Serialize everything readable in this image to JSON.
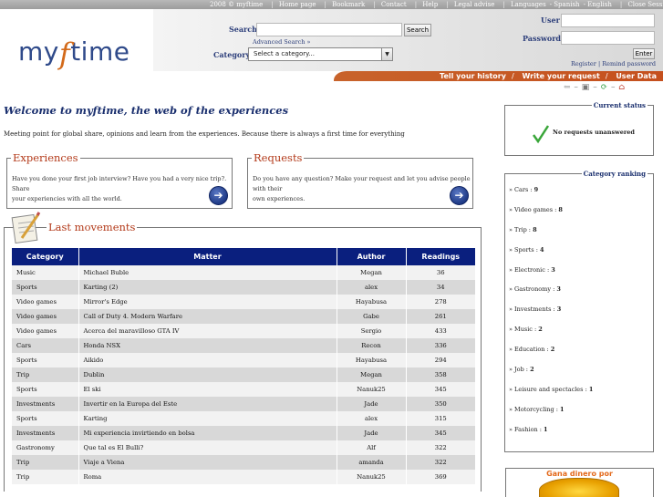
{
  "topbar": {
    "copyright": "2008 © myftime",
    "links": [
      "Home page",
      "Bookmark",
      "Contact",
      "Help",
      "Legal advise"
    ],
    "languages_label": "Languages",
    "languages": [
      "Spanish",
      "English"
    ],
    "close_session": "Close Session"
  },
  "logo": {
    "pre": "my",
    "f": "f",
    "post": "time"
  },
  "search": {
    "label": "Search",
    "button": "Search",
    "advanced": "Advanced Search »",
    "category_label": "Category",
    "category_value": "Select a category..."
  },
  "login": {
    "user_label": "User",
    "password_label": "Password",
    "enter_button": "Enter",
    "register": "Register",
    "remind": "Remind password"
  },
  "nav": {
    "items": [
      "Tell your history",
      "Write your request",
      "User Data"
    ]
  },
  "welcome": {
    "title": "Welcome to myftime, the web of the experiences",
    "intro": "Meeting point for global share, opinions and learn from the experiences. Because there is always a first time for everything"
  },
  "experiences": {
    "title": "Experiences",
    "text_line1": "Have you done your first job interview? Have you had a very nice trip?. Share",
    "text_line2": "your experiencies with all the world."
  },
  "requests": {
    "title": "Requests",
    "text_line1": "Do you have any question? Make your request and let you advise people with their",
    "text_line2": "own experiences."
  },
  "movements": {
    "title": "Last movements",
    "columns": [
      "Category",
      "Matter",
      "Author",
      "Readings"
    ],
    "rows": [
      [
        "Music",
        "Michael Buble",
        "Megan",
        "36"
      ],
      [
        "Sports",
        "Karting (2)",
        "alex",
        "34"
      ],
      [
        "Video games",
        "Mirror's Edge",
        "Hayabusa",
        "278"
      ],
      [
        "Video games",
        "Call of Duty 4. Modern Warfare",
        "Gabe",
        "261"
      ],
      [
        "Video games",
        "Acerca del maravilloso GTA IV",
        "Sergio",
        "433"
      ],
      [
        "Cars",
        "Honda NSX",
        "Recon",
        "336"
      ],
      [
        "Sports",
        "Aikido",
        "Hayabusa",
        "294"
      ],
      [
        "Trip",
        "Dublin",
        "Megan",
        "358"
      ],
      [
        "Sports",
        "El ski",
        "Nanuk25",
        "345"
      ],
      [
        "Investments",
        "Invertir en la Europa del Este",
        "Jade",
        "350"
      ],
      [
        "Sports",
        "Karting",
        "alex",
        "315"
      ],
      [
        "Investments",
        "Mi experiencia invirtiendo en bolsa",
        "Jade",
        "345"
      ],
      [
        "Gastronomy",
        "Que tal es El Bulli?",
        "Alf",
        "322"
      ],
      [
        "Trip",
        "Viaje a Viena",
        "amanda",
        "322"
      ],
      [
        "Trip",
        "Roma",
        "Nanuk25",
        "369"
      ]
    ]
  },
  "status": {
    "title": "Current status",
    "text": "No requests unanswered"
  },
  "ranking": {
    "title": "Category ranking",
    "items": [
      {
        "name": "Cars",
        "count": "9"
      },
      {
        "name": "Video games",
        "count": "8"
      },
      {
        "name": "Trip",
        "count": "8"
      },
      {
        "name": "Sports",
        "count": "4"
      },
      {
        "name": "Electronic",
        "count": "3"
      },
      {
        "name": "Gastronomy",
        "count": "3"
      },
      {
        "name": "Investments",
        "count": "3"
      },
      {
        "name": "Music",
        "count": "2"
      },
      {
        "name": "Education",
        "count": "2"
      },
      {
        "name": "Job",
        "count": "2"
      },
      {
        "name": "Leisure and spectacles",
        "count": "1"
      },
      {
        "name": "Motorcycling",
        "count": "1"
      },
      {
        "name": "Fashion",
        "count": "1"
      }
    ]
  },
  "ad": {
    "text": "Gana dinero por"
  },
  "colors": {
    "brand_blue": "#0a1f7e",
    "accent_orange": "#c8632b",
    "title_red": "#b33a1a"
  }
}
